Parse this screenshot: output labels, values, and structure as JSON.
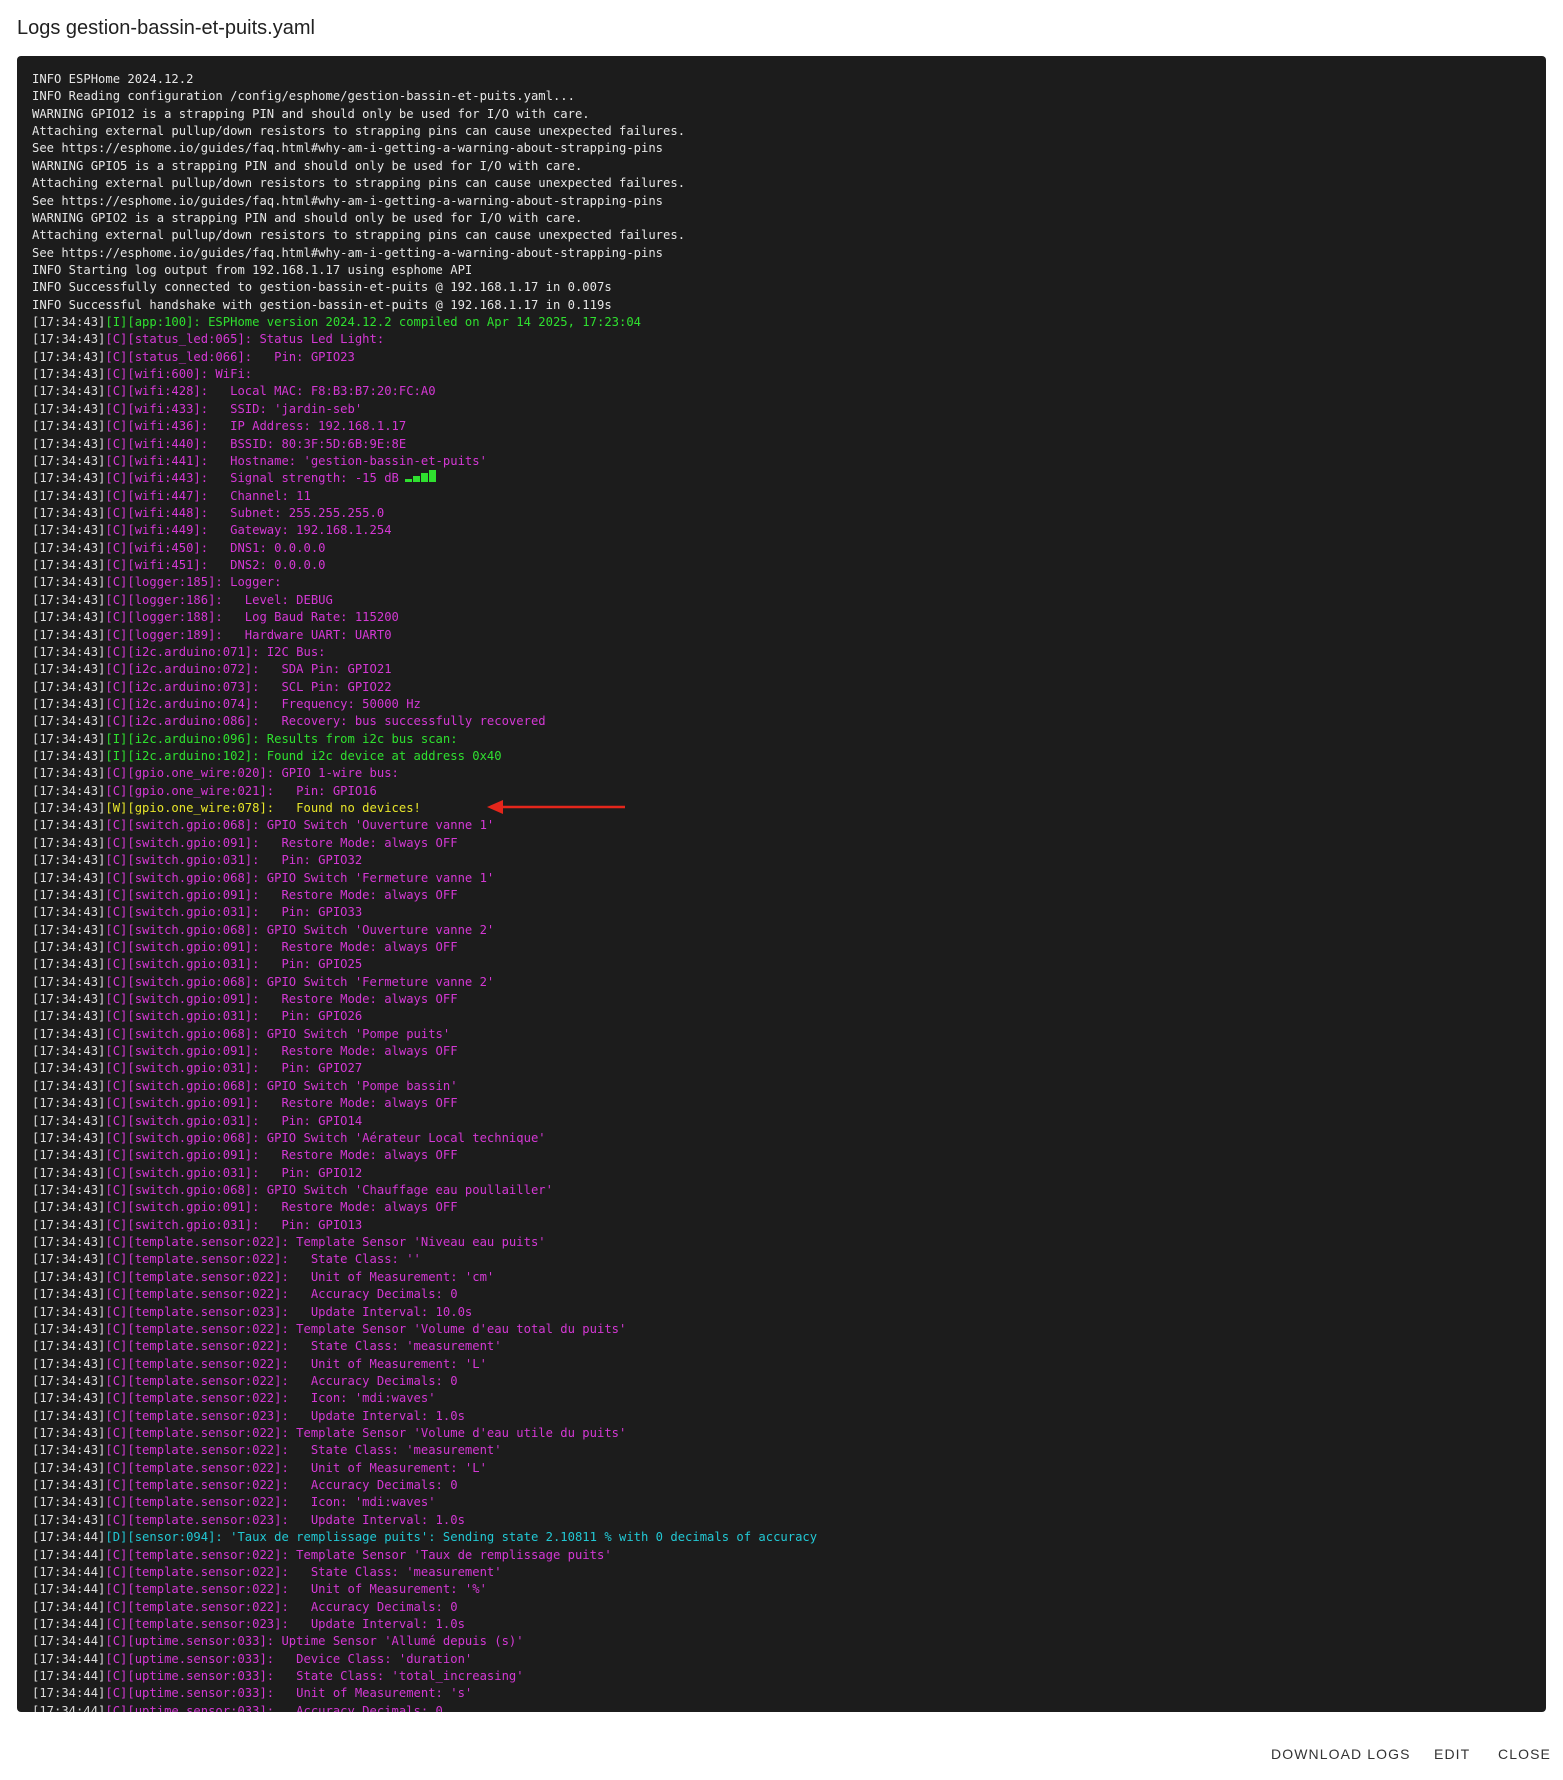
{
  "dialog": {
    "title": "Logs gestion-bassin-et-puits.yaml"
  },
  "log": {
    "colors": {
      "info": "#2fe02f",
      "config": "#d438d4",
      "warning": "#e8e62a",
      "debug": "#22c8d4",
      "plain": "#e6e6e6",
      "arrow": "#e4261b",
      "background": "#1c1c1c"
    },
    "lines": [
      {
        "plain": "INFO ESPHome 2024.12.2"
      },
      {
        "plain": "INFO Reading configuration /config/esphome/gestion-bassin-et-puits.yaml..."
      },
      {
        "plain": "WARNING GPIO12 is a strapping PIN and should only be used for I/O with care."
      },
      {
        "plain": "Attaching external pullup/down resistors to strapping pins can cause unexpected failures."
      },
      {
        "plain": "See https://esphome.io/guides/faq.html#why-am-i-getting-a-warning-about-strapping-pins"
      },
      {
        "plain": "WARNING GPIO5 is a strapping PIN and should only be used for I/O with care."
      },
      {
        "plain": "Attaching external pullup/down resistors to strapping pins can cause unexpected failures."
      },
      {
        "plain": "See https://esphome.io/guides/faq.html#why-am-i-getting-a-warning-about-strapping-pins"
      },
      {
        "plain": "WARNING GPIO2 is a strapping PIN and should only be used for I/O with care."
      },
      {
        "plain": "Attaching external pullup/down resistors to strapping pins can cause unexpected failures."
      },
      {
        "plain": "See https://esphome.io/guides/faq.html#why-am-i-getting-a-warning-about-strapping-pins"
      },
      {
        "plain": "INFO Starting log output from 192.168.1.17 using esphome API"
      },
      {
        "plain": "INFO Successfully connected to gestion-bassin-et-puits @ 192.168.1.17 in 0.007s"
      },
      {
        "plain": "INFO Successful handshake with gestion-bassin-et-puits @ 192.168.1.17 in 0.119s"
      },
      {
        "ts": "[17:34:43]",
        "level": "I",
        "text": "[I][app:100]: ESPHome version 2024.12.2 compiled on Apr 14 2025, 17:23:04"
      },
      {
        "ts": "[17:34:43]",
        "level": "C",
        "text": "[C][status_led:065]: Status Led Light:"
      },
      {
        "ts": "[17:34:43]",
        "level": "C",
        "text": "[C][status_led:066]:   Pin: GPIO23"
      },
      {
        "ts": "[17:34:43]",
        "level": "C",
        "text": "[C][wifi:600]: WiFi:"
      },
      {
        "ts": "[17:34:43]",
        "level": "C",
        "text": "[C][wifi:428]:   Local MAC: F8:B3:B7:20:FC:A0"
      },
      {
        "ts": "[17:34:43]",
        "level": "C",
        "text": "[C][wifi:433]:   SSID: 'jardin-seb'"
      },
      {
        "ts": "[17:34:43]",
        "level": "C",
        "text": "[C][wifi:436]:   IP Address: 192.168.1.17"
      },
      {
        "ts": "[17:34:43]",
        "level": "C",
        "text": "[C][wifi:440]:   BSSID: 80:3F:5D:6B:9E:8E"
      },
      {
        "ts": "[17:34:43]",
        "level": "C",
        "text": "[C][wifi:441]:   Hostname: 'gestion-bassin-et-puits'"
      },
      {
        "ts": "[17:34:43]",
        "level": "C",
        "text": "[C][wifi:443]:   Signal strength: -15 dB",
        "signal_icon": "signal-bars-icon"
      },
      {
        "ts": "[17:34:43]",
        "level": "C",
        "text": "[C][wifi:447]:   Channel: 11"
      },
      {
        "ts": "[17:34:43]",
        "level": "C",
        "text": "[C][wifi:448]:   Subnet: 255.255.255.0"
      },
      {
        "ts": "[17:34:43]",
        "level": "C",
        "text": "[C][wifi:449]:   Gateway: 192.168.1.254"
      },
      {
        "ts": "[17:34:43]",
        "level": "C",
        "text": "[C][wifi:450]:   DNS1: 0.0.0.0"
      },
      {
        "ts": "[17:34:43]",
        "level": "C",
        "text": "[C][wifi:451]:   DNS2: 0.0.0.0"
      },
      {
        "ts": "[17:34:43]",
        "level": "C",
        "text": "[C][logger:185]: Logger:"
      },
      {
        "ts": "[17:34:43]",
        "level": "C",
        "text": "[C][logger:186]:   Level: DEBUG"
      },
      {
        "ts": "[17:34:43]",
        "level": "C",
        "text": "[C][logger:188]:   Log Baud Rate: 115200"
      },
      {
        "ts": "[17:34:43]",
        "level": "C",
        "text": "[C][logger:189]:   Hardware UART: UART0"
      },
      {
        "ts": "[17:34:43]",
        "level": "C",
        "text": "[C][i2c.arduino:071]: I2C Bus:"
      },
      {
        "ts": "[17:34:43]",
        "level": "C",
        "text": "[C][i2c.arduino:072]:   SDA Pin: GPIO21"
      },
      {
        "ts": "[17:34:43]",
        "level": "C",
        "text": "[C][i2c.arduino:073]:   SCL Pin: GPIO22"
      },
      {
        "ts": "[17:34:43]",
        "level": "C",
        "text": "[C][i2c.arduino:074]:   Frequency: 50000 Hz"
      },
      {
        "ts": "[17:34:43]",
        "level": "C",
        "text": "[C][i2c.arduino:086]:   Recovery: bus successfully recovered"
      },
      {
        "ts": "[17:34:43]",
        "level": "I",
        "text": "[I][i2c.arduino:096]: Results from i2c bus scan:"
      },
      {
        "ts": "[17:34:43]",
        "level": "I",
        "text": "[I][i2c.arduino:102]: Found i2c device at address 0x40"
      },
      {
        "ts": "[17:34:43]",
        "level": "C",
        "text": "[C][gpio.one_wire:020]: GPIO 1-wire bus:"
      },
      {
        "ts": "[17:34:43]",
        "level": "C",
        "text": "[C][gpio.one_wire:021]:   Pin: GPIO16"
      },
      {
        "ts": "[17:34:43]",
        "level": "W",
        "text": "[W][gpio.one_wire:078]:   Found no devices!",
        "arrow_icon": "red-arrow-icon"
      },
      {
        "ts": "[17:34:43]",
        "level": "C",
        "text": "[C][switch.gpio:068]: GPIO Switch 'Ouverture vanne 1'"
      },
      {
        "ts": "[17:34:43]",
        "level": "C",
        "text": "[C][switch.gpio:091]:   Restore Mode: always OFF"
      },
      {
        "ts": "[17:34:43]",
        "level": "C",
        "text": "[C][switch.gpio:031]:   Pin: GPIO32"
      },
      {
        "ts": "[17:34:43]",
        "level": "C",
        "text": "[C][switch.gpio:068]: GPIO Switch 'Fermeture vanne 1'"
      },
      {
        "ts": "[17:34:43]",
        "level": "C",
        "text": "[C][switch.gpio:091]:   Restore Mode: always OFF"
      },
      {
        "ts": "[17:34:43]",
        "level": "C",
        "text": "[C][switch.gpio:031]:   Pin: GPIO33"
      },
      {
        "ts": "[17:34:43]",
        "level": "C",
        "text": "[C][switch.gpio:068]: GPIO Switch 'Ouverture vanne 2'"
      },
      {
        "ts": "[17:34:43]",
        "level": "C",
        "text": "[C][switch.gpio:091]:   Restore Mode: always OFF"
      },
      {
        "ts": "[17:34:43]",
        "level": "C",
        "text": "[C][switch.gpio:031]:   Pin: GPIO25"
      },
      {
        "ts": "[17:34:43]",
        "level": "C",
        "text": "[C][switch.gpio:068]: GPIO Switch 'Fermeture vanne 2'"
      },
      {
        "ts": "[17:34:43]",
        "level": "C",
        "text": "[C][switch.gpio:091]:   Restore Mode: always OFF"
      },
      {
        "ts": "[17:34:43]",
        "level": "C",
        "text": "[C][switch.gpio:031]:   Pin: GPIO26"
      },
      {
        "ts": "[17:34:43]",
        "level": "C",
        "text": "[C][switch.gpio:068]: GPIO Switch 'Pompe puits'"
      },
      {
        "ts": "[17:34:43]",
        "level": "C",
        "text": "[C][switch.gpio:091]:   Restore Mode: always OFF"
      },
      {
        "ts": "[17:34:43]",
        "level": "C",
        "text": "[C][switch.gpio:031]:   Pin: GPIO27"
      },
      {
        "ts": "[17:34:43]",
        "level": "C",
        "text": "[C][switch.gpio:068]: GPIO Switch 'Pompe bassin'"
      },
      {
        "ts": "[17:34:43]",
        "level": "C",
        "text": "[C][switch.gpio:091]:   Restore Mode: always OFF"
      },
      {
        "ts": "[17:34:43]",
        "level": "C",
        "text": "[C][switch.gpio:031]:   Pin: GPIO14"
      },
      {
        "ts": "[17:34:43]",
        "level": "C",
        "text": "[C][switch.gpio:068]: GPIO Switch 'Aérateur Local technique'"
      },
      {
        "ts": "[17:34:43]",
        "level": "C",
        "text": "[C][switch.gpio:091]:   Restore Mode: always OFF"
      },
      {
        "ts": "[17:34:43]",
        "level": "C",
        "text": "[C][switch.gpio:031]:   Pin: GPIO12"
      },
      {
        "ts": "[17:34:43]",
        "level": "C",
        "text": "[C][switch.gpio:068]: GPIO Switch 'Chauffage eau poullailler'"
      },
      {
        "ts": "[17:34:43]",
        "level": "C",
        "text": "[C][switch.gpio:091]:   Restore Mode: always OFF"
      },
      {
        "ts": "[17:34:43]",
        "level": "C",
        "text": "[C][switch.gpio:031]:   Pin: GPIO13"
      },
      {
        "ts": "[17:34:43]",
        "level": "C",
        "text": "[C][template.sensor:022]: Template Sensor 'Niveau eau puits'"
      },
      {
        "ts": "[17:34:43]",
        "level": "C",
        "text": "[C][template.sensor:022]:   State Class: ''"
      },
      {
        "ts": "[17:34:43]",
        "level": "C",
        "text": "[C][template.sensor:022]:   Unit of Measurement: 'cm'"
      },
      {
        "ts": "[17:34:43]",
        "level": "C",
        "text": "[C][template.sensor:022]:   Accuracy Decimals: 0"
      },
      {
        "ts": "[17:34:43]",
        "level": "C",
        "text": "[C][template.sensor:023]:   Update Interval: 10.0s"
      },
      {
        "ts": "[17:34:43]",
        "level": "C",
        "text": "[C][template.sensor:022]: Template Sensor 'Volume d'eau total du puits'"
      },
      {
        "ts": "[17:34:43]",
        "level": "C",
        "text": "[C][template.sensor:022]:   State Class: 'measurement'"
      },
      {
        "ts": "[17:34:43]",
        "level": "C",
        "text": "[C][template.sensor:022]:   Unit of Measurement: 'L'"
      },
      {
        "ts": "[17:34:43]",
        "level": "C",
        "text": "[C][template.sensor:022]:   Accuracy Decimals: 0"
      },
      {
        "ts": "[17:34:43]",
        "level": "C",
        "text": "[C][template.sensor:022]:   Icon: 'mdi:waves'"
      },
      {
        "ts": "[17:34:43]",
        "level": "C",
        "text": "[C][template.sensor:023]:   Update Interval: 1.0s"
      },
      {
        "ts": "[17:34:43]",
        "level": "C",
        "text": "[C][template.sensor:022]: Template Sensor 'Volume d'eau utile du puits'"
      },
      {
        "ts": "[17:34:43]",
        "level": "C",
        "text": "[C][template.sensor:022]:   State Class: 'measurement'"
      },
      {
        "ts": "[17:34:43]",
        "level": "C",
        "text": "[C][template.sensor:022]:   Unit of Measurement: 'L'"
      },
      {
        "ts": "[17:34:43]",
        "level": "C",
        "text": "[C][template.sensor:022]:   Accuracy Decimals: 0"
      },
      {
        "ts": "[17:34:43]",
        "level": "C",
        "text": "[C][template.sensor:022]:   Icon: 'mdi:waves'"
      },
      {
        "ts": "[17:34:43]",
        "level": "C",
        "text": "[C][template.sensor:023]:   Update Interval: 1.0s"
      },
      {
        "ts": "[17:34:44]",
        "level": "D",
        "text": "[D][sensor:094]: 'Taux de remplissage puits': Sending state 2.10811 % with 0 decimals of accuracy"
      },
      {
        "ts": "[17:34:44]",
        "level": "C",
        "text": "[C][template.sensor:022]: Template Sensor 'Taux de remplissage puits'"
      },
      {
        "ts": "[17:34:44]",
        "level": "C",
        "text": "[C][template.sensor:022]:   State Class: 'measurement'"
      },
      {
        "ts": "[17:34:44]",
        "level": "C",
        "text": "[C][template.sensor:022]:   Unit of Measurement: '%'"
      },
      {
        "ts": "[17:34:44]",
        "level": "C",
        "text": "[C][template.sensor:022]:   Accuracy Decimals: 0"
      },
      {
        "ts": "[17:34:44]",
        "level": "C",
        "text": "[C][template.sensor:023]:   Update Interval: 1.0s"
      },
      {
        "ts": "[17:34:44]",
        "level": "C",
        "text": "[C][uptime.sensor:033]: Uptime Sensor 'Allumé depuis (s)'"
      },
      {
        "ts": "[17:34:44]",
        "level": "C",
        "text": "[C][uptime.sensor:033]:   Device Class: 'duration'"
      },
      {
        "ts": "[17:34:44]",
        "level": "C",
        "text": "[C][uptime.sensor:033]:   State Class: 'total_increasing'"
      },
      {
        "ts": "[17:34:44]",
        "level": "C",
        "text": "[C][uptime.sensor:033]:   Unit of Measurement: 's'"
      },
      {
        "ts": "[17:34:44]",
        "level": "C",
        "text": "[C][uptime.sensor:033]:   Accuracy Decimals: 0"
      }
    ]
  },
  "actions": {
    "download_label": "DOWNLOAD LOGS",
    "edit_label": "EDIT",
    "close_label": "CLOSE"
  }
}
